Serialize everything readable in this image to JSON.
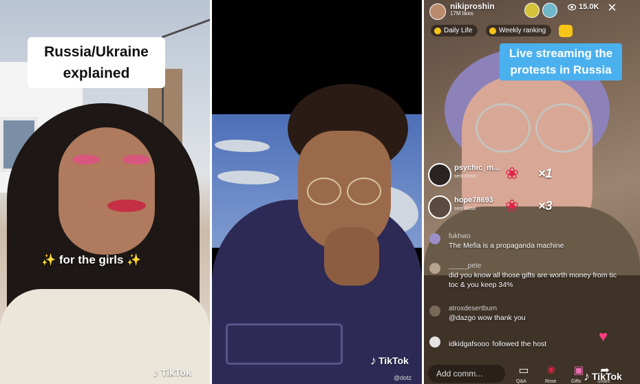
{
  "panel1": {
    "caption": "Russia/Ukraine explained",
    "subcaption": "✨ for the girls ✨",
    "watermark": "TikTok"
  },
  "panel2": {
    "watermark": "TikTok",
    "handle": "@dotz"
  },
  "panel3": {
    "host": {
      "name": "nikiproshin",
      "likes": "17M likes"
    },
    "viewer_count": "15.0K",
    "pills": [
      {
        "label": "Daily Life"
      },
      {
        "label": "Weekly ranking"
      }
    ],
    "caption": "Live streaming the protests in Russia",
    "gifts": [
      {
        "user": "psychic_m...",
        "sub": "sent Rose",
        "count": "×1"
      },
      {
        "user": "hope78693",
        "sub": "sent Rose",
        "count": "×3"
      }
    ],
    "comments": [
      {
        "user": "fukhwo",
        "text": "The Mefia is a propaganda machine"
      },
      {
        "user": "_____pete",
        "text": "did you know all those gifts are worth money from tic toc & you keep 34%"
      },
      {
        "user": "atroxdesertburn",
        "text": "@dazgo wow thank you"
      }
    ],
    "join": {
      "user": "idkidgafsooo",
      "text": "followed the host"
    },
    "input_placeholder": "Add comm...",
    "tools": [
      "Q&A",
      "Rose",
      "Gifts",
      "Share"
    ],
    "watermark": "TikTok",
    "colors": {
      "caption_bg": "#4ab0ee",
      "rose": "#e1244a",
      "coin": "#f5c518"
    },
    "icons": {
      "close": "close-icon",
      "eye": "eye-icon",
      "rose": "rose-icon",
      "heart": "heart-icon"
    }
  }
}
